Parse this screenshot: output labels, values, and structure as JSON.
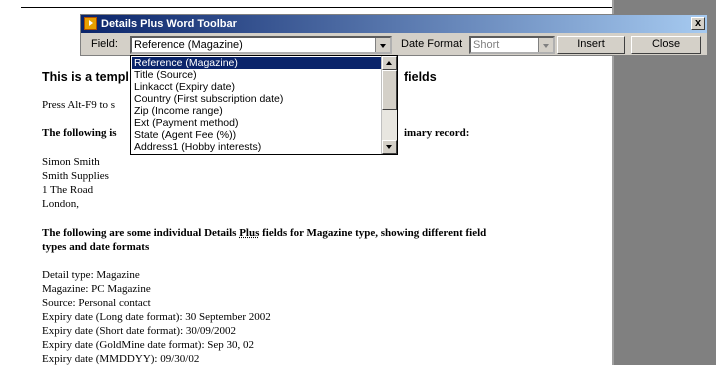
{
  "toolbar": {
    "title": "Details Plus Word Toolbar",
    "close_glyph": "x",
    "field_label": "Field:",
    "field_value": "Reference (Magazine)",
    "date_format_label": "Date Format",
    "date_format_value": "Short",
    "insert_label": "Insert",
    "close_label": "Close"
  },
  "dropdown": {
    "items": [
      "Reference (Magazine)",
      "Title (Source)",
      "Linkacct (Expiry date)",
      "Country (First subscription date)",
      "Zip (Income range)",
      "Ext (Payment method)",
      "State (Agent Fee (%))",
      "Address1 (Hobby interests)"
    ]
  },
  "document": {
    "heading_left": "This is a templ",
    "heading_right": "fields",
    "press_line": "Press Alt-F9 to s",
    "following_left": "The following is",
    "following_right": "imary record:",
    "address": [
      "Simon Smith",
      "Smith Supplies",
      "1 The Road",
      "London,"
    ],
    "fields_heading_1a": "The following are some individual Details ",
    "fields_heading_1b": "Plus",
    "fields_heading_1c": " fields for Magazine type, showing different field",
    "fields_heading_2": "types and date formats",
    "detail_lines": [
      "Detail type: Magazine",
      "Magazine: PC Magazine",
      "Source: Personal contact",
      "Expiry date (Long date format): 30 September 2002",
      "Expiry date (Short date format): 30/09/2002",
      "Expiry date (GoldMine date format): Sep 30, 02",
      "Expiry date (MMDDYY): 09/30/02"
    ]
  }
}
